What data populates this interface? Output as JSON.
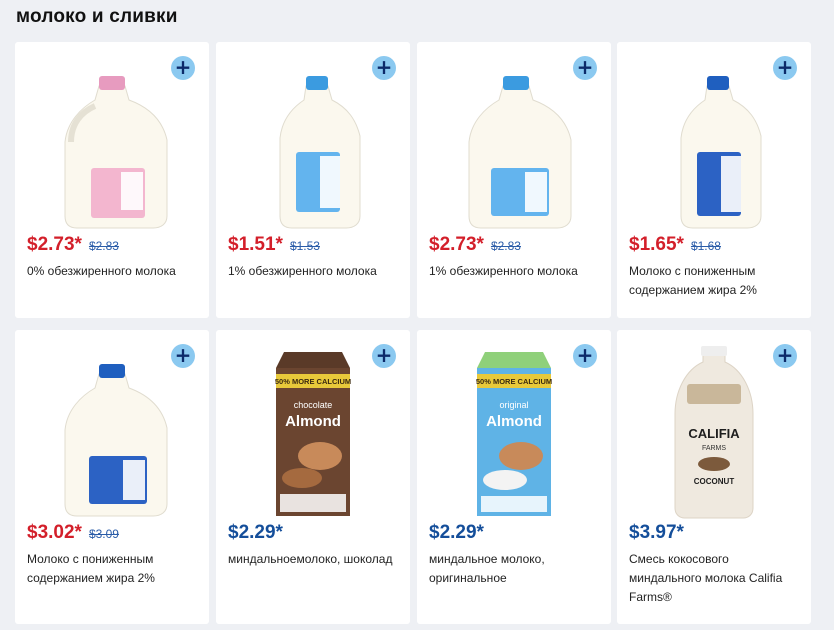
{
  "section": {
    "title": "молоко и сливки"
  },
  "add_label": "+",
  "products": [
    {
      "price": "$2.73*",
      "old_price": "$2.83",
      "name": "0% обезжиренного молока",
      "on_sale": true,
      "cap_color": "#e79bbf",
      "label_color": "#f3b6cf"
    },
    {
      "price": "$1.51*",
      "old_price": "$1.53",
      "name": "1% обезжиренного молока",
      "on_sale": true,
      "cap_color": "#3b9be0",
      "label_color": "#63b4ee"
    },
    {
      "price": "$2.73*",
      "old_price": "$2.83",
      "name": "1% обезжиренного молока",
      "on_sale": true,
      "cap_color": "#3b9be0",
      "label_color": "#63b4ee"
    },
    {
      "price": "$1.65*",
      "old_price": "$1.68",
      "name": "Молоко с пониженным содержанием жира 2%",
      "on_sale": true,
      "cap_color": "#1f5fbf",
      "label_color": "#2c62c4"
    },
    {
      "price": "$3.02*",
      "old_price": "$3.09",
      "name": "Молоко с пониженным содержанием жира 2%",
      "on_sale": true,
      "cap_color": "#1f5fbf",
      "label_color": "#2c62c4"
    },
    {
      "price": "$2.29*",
      "old_price": "",
      "name": "миндальноемолоко, шоколад",
      "on_sale": false,
      "carton_banner": "50% MORE CALCIUM",
      "carton_flavor": "chocolate",
      "carton_brand": "Almond",
      "carton_color": "#5a3a28"
    },
    {
      "price": "$2.29*",
      "old_price": "",
      "name": "миндальное молоко, оригинальное",
      "on_sale": false,
      "carton_banner": "50% MORE CALCIUM",
      "carton_flavor": "original",
      "carton_brand": "Almond",
      "carton_color": "#3f9bd6"
    },
    {
      "price": "$3.97*",
      "old_price": "",
      "name": "Смесь кокосового миндального молока Califia Farms®",
      "on_sale": false,
      "bottle_brand": "CALIFIA",
      "bottle_sub": "FARMS",
      "bottle_flavor": "COCONUT"
    }
  ]
}
